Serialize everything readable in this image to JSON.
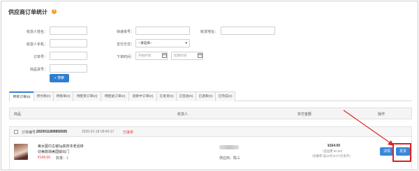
{
  "page": {
    "title": "供应商订单统计",
    "help_icon": "help-icon"
  },
  "filters": {
    "receiver_name_label": "收货人姓名：",
    "receiver_phone_label": "收货人手机：",
    "order_no_label": "订单号：",
    "product_no_label": "商品货号：",
    "express_no_label": "快递单号：",
    "payment_label": "支付方式：",
    "payment_value": "--请选择--",
    "order_time_label": "下单时间：",
    "start_time_placeholder": "开始时间",
    "end_time_placeholder": "结束时间",
    "address_label": "收货地址：",
    "search_button": "搜索",
    "search_icon": "search-icon"
  },
  "tabs": [
    {
      "label": "所有订单(0)",
      "active": true
    },
    {
      "label": "待付款(0)"
    },
    {
      "label": "待接单(0)"
    },
    {
      "label": "待配货订单(0)"
    },
    {
      "label": "待配送订单(0)"
    },
    {
      "label": "退款中订单(0)"
    },
    {
      "label": "已发货(0)"
    },
    {
      "label": "已签收(0)"
    },
    {
      "label": "已退款(0)"
    },
    {
      "label": "已完成(0)"
    }
  ],
  "table": {
    "headers": [
      "商品",
      "收货人",
      "实付金额",
      "操作"
    ]
  },
  "order": {
    "order_no_label": "订单编号：",
    "order_no": "2020011899856505",
    "time": "2020-01-18 09:40:17",
    "status": "已接单",
    "product_name_line1": "美女图巾古装5g高药本老话袜",
    "product_name_line2": "切美酚渐美国疑出门",
    "product_price": "¥149.00",
    "product_qty": "数量：1",
    "supplier": "供应商：陈三",
    "paid_amount": "¥164.00",
    "shipping_fee": "（含运费 ¥0.00）",
    "payment_method": "（优惠券 返10元/27六元金币）",
    "detail_button": "详情",
    "ship_button": "发货"
  }
}
